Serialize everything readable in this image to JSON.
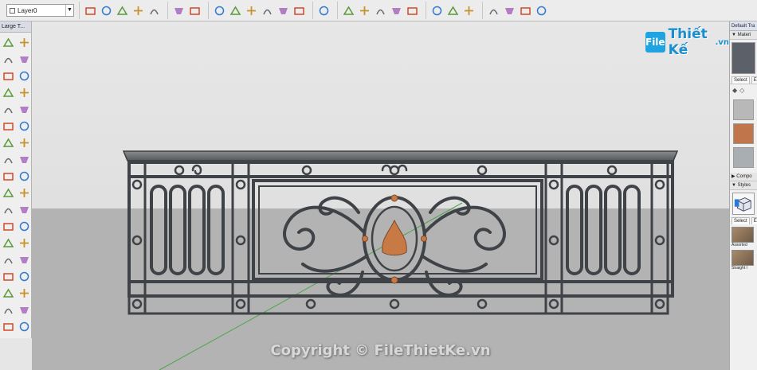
{
  "toolbar": {
    "layer_name": "Layer0",
    "groups": [
      [
        "layer-dropdown-icon"
      ],
      [
        "warehouse-icon",
        "add-location-icon",
        "component-icon",
        "extension-icon",
        "sandbox-icon"
      ],
      [
        "paint-bucket-icon",
        "make-group-icon"
      ],
      [
        "iso-view-icon",
        "top-view-icon",
        "front-view-icon",
        "right-view-icon",
        "back-view-icon",
        "left-view-icon"
      ],
      [
        "section-plane-icon"
      ],
      [
        "protractor-icon",
        "dimension-icon",
        "text-label-icon",
        "axes-icon",
        "3d-text-icon"
      ],
      [
        "check-icon",
        "teapot-icon",
        "shadow-icon"
      ],
      [
        "layers-icon",
        "outliner-icon",
        "scenes-icon",
        "fog-icon"
      ]
    ]
  },
  "left_palette": {
    "title": "Large T...",
    "tools": [
      "select-icon",
      "eraser-icon",
      "paint-icon",
      "eraser-alt-icon",
      "line-icon",
      "freehand-icon",
      "rectangle-icon",
      "rotated-rectangle-icon",
      "circle-icon",
      "polygon-icon",
      "arc-icon",
      "arc-two-point-icon",
      "pie-icon",
      "arc-three-point-icon",
      "move-icon",
      "push-pull-icon",
      "rotate-icon",
      "follow-me-icon",
      "scale-icon",
      "offset-icon",
      "tape-measure-icon",
      "dimension-tool-icon",
      "protractor-tool-icon",
      "text-tool-icon",
      "axes-tool-icon",
      "3d-text-tool-icon",
      "orbit-icon",
      "pan-icon",
      "zoom-icon",
      "zoom-window-icon",
      "zoom-extents-icon",
      "previous-view-icon",
      "position-camera-icon",
      "look-around-icon",
      "walk-icon",
      "section-tool-icon"
    ]
  },
  "watermark": {
    "logo_mark": "File",
    "logo_text": "Thiết Kế",
    "logo_suffix": ".vn",
    "copyright": "Copyright © FileThietKe.vn"
  },
  "tray": {
    "title": "Default Tra",
    "materials_header": "▼ Materi",
    "select_tab": "Select",
    "edit_tab": "Ec",
    "swatches": [
      "#b8b8b8",
      "#c0764a",
      "#a9aeb3"
    ],
    "components_header": "▶ Compo",
    "styles_header": "▼ Styles",
    "styles_select_tab": "Select",
    "styles_edit_tab": "Ec",
    "style_items": [
      {
        "label": "Assorted"
      },
      {
        "label": "Straight l"
      }
    ]
  },
  "colors": {
    "iron": "#3f4246",
    "rail_top": "#6b6e70",
    "ornament": "#c87a45",
    "axis_green": "#4aa64a",
    "sky": "#e3e3e3",
    "ground": "#b3b3b3"
  }
}
